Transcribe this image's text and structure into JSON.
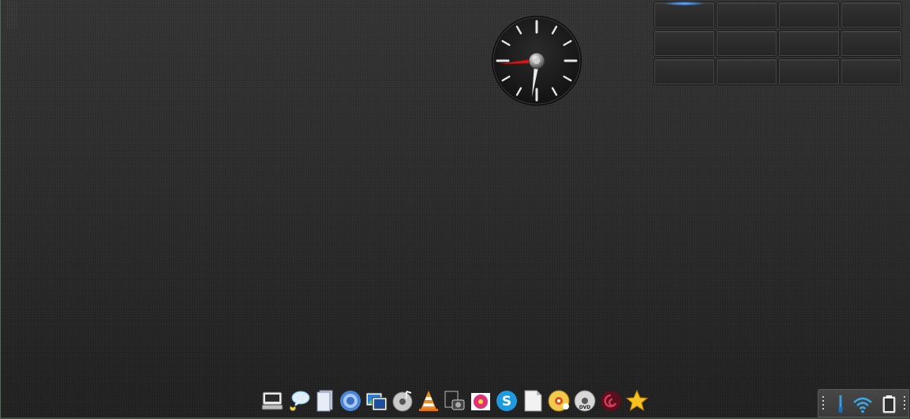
{
  "desktop": {
    "background_color": "#2a2a2a"
  },
  "clock": {
    "face_color": "#1c1c1c",
    "hour_hand_color": "#e8e8e8",
    "second_hand_color": "#e01010"
  },
  "pager": {
    "active_desktop_color": "#4a9cff",
    "desktops": [
      {
        "active": true
      },
      {
        "active": false
      },
      {
        "active": false
      },
      {
        "active": false
      },
      {
        "active": false
      },
      {
        "active": false
      },
      {
        "active": false
      },
      {
        "active": false
      },
      {
        "active": false
      },
      {
        "active": false
      },
      {
        "active": false
      },
      {
        "active": false
      }
    ]
  },
  "dock": {
    "icons": [
      "drive-icon",
      "chat-icon",
      "files-icon",
      "browser-icon",
      "image-viewer-icon",
      "music-disc-icon",
      "vlc-cone-icon",
      "screenshot-icon",
      "flower-app-icon",
      "skype-icon",
      "document-icon",
      "disc-burner-icon",
      "dvd-icon",
      "debian-swirl-icon",
      "favorites-star-icon"
    ]
  },
  "tray": {
    "icons": [
      "brush-icon",
      "wifi-icon",
      "battery-icon"
    ],
    "wifi_color": "#3aa6e6"
  }
}
